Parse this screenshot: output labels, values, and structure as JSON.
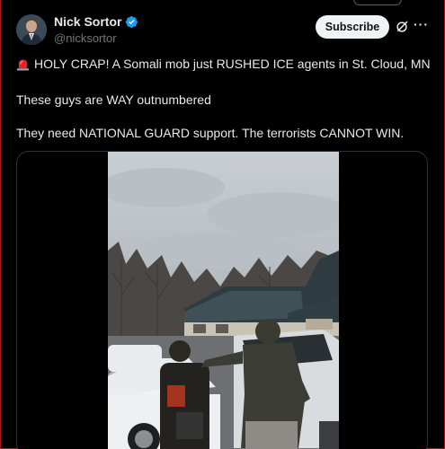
{
  "author": {
    "name": "Nick Sortor",
    "handle": "@nicksortor",
    "verified": true
  },
  "actions": {
    "subscribe_label": "Subscribe",
    "grok_icon": "grok-icon",
    "more_icon": "more-icon"
  },
  "post": {
    "line1": "HOLY CRAP! A Somali mob just RUSHED ICE agents in St. Cloud, MN",
    "line1_icon": "police-siren-emoji",
    "line2": "These guys are WAY outnumbered",
    "line3": "They need NATIONAL GUARD support. The terrorists CANNOT WIN."
  },
  "colors": {
    "background": "#000000",
    "text": "#e7e9ea",
    "secondary_text": "#71767b",
    "verified_blue": "#1d9bf0",
    "button_bg": "#eff3f4",
    "frame_border": "#b5121b"
  }
}
